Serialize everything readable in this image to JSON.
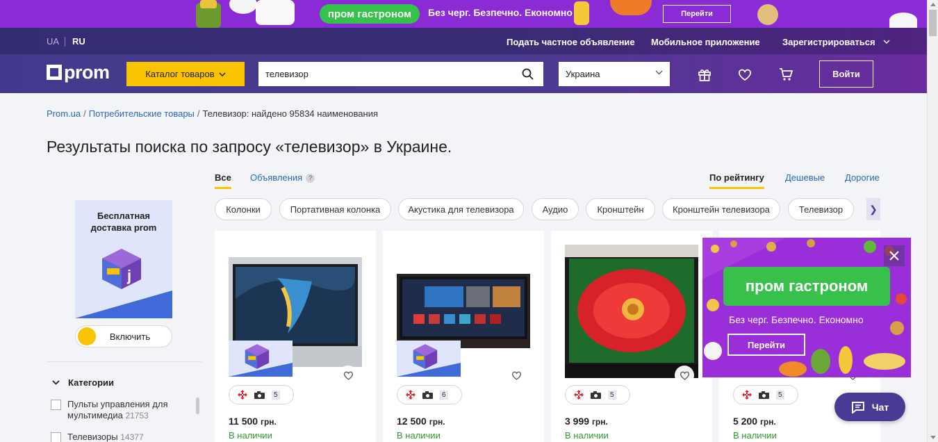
{
  "promo_banner": {
    "brand_text": "пром гастроном",
    "tagline": "Без черг. Безпечно. Економно",
    "button_label": "Перейти"
  },
  "header": {
    "languages": [
      "UA",
      "RU"
    ],
    "active_language": "RU",
    "top_links": [
      "Подать частное объявление",
      "Мобильное приложение",
      "Зарегистрироваться"
    ],
    "logo_text": "prom",
    "catalog_label": "Каталог товаров",
    "search_value": "телевизор",
    "region_value": "Украина",
    "login_label": "Войти"
  },
  "breadcrumb": {
    "items": [
      "Prom.ua",
      "Потребительские товары"
    ],
    "current": "Телевизор: найдено 95834 наименования"
  },
  "page_title": "Результаты поиска по запросу «телевизор» в Украине.",
  "sidebar": {
    "promo_title": "Бесплатная доставка prom",
    "toggle_label": "Включить",
    "categories_heading": "Категории",
    "categories": [
      {
        "label": "Пульты управления для мультимедиа",
        "count": "21753"
      },
      {
        "label": "Телевизоры",
        "count": "14377"
      }
    ]
  },
  "tabs": {
    "left": [
      "Все",
      "Объявления"
    ],
    "help_badge": "?",
    "sort": [
      "По рейтингу",
      "Дешевые",
      "Дорогие"
    ]
  },
  "chips": [
    "Колонки",
    "Портативная колонка",
    "Акустика для телевизора",
    "Аудио",
    "Кронштейн",
    "Кронштейн телевизора",
    "Телевизор"
  ],
  "products": [
    {
      "price": "11 500",
      "currency": "грн.",
      "stock": "В наличии",
      "photos": "5"
    },
    {
      "price": "12 500",
      "currency": "грн.",
      "stock": "В наличии",
      "photos": "6"
    },
    {
      "price": "3 999",
      "currency": "грн.",
      "stock": "В наличии",
      "photos": "5"
    },
    {
      "price": "5 200",
      "currency": "грн.",
      "stock": "В наличии",
      "photos": "5"
    }
  ],
  "overlay_ad": {
    "brand_text": "пром гастроном",
    "tagline": "Без черг. Безпечно. Економно",
    "button_label": "Перейти"
  },
  "chat": {
    "label": "Чат"
  },
  "colors": {
    "accent_yellow": "#f8c300",
    "header_purple": "#413a8c",
    "link_blue": "#2769b8",
    "stock_green": "#2d9b2d",
    "promo_green": "#35c24a"
  }
}
